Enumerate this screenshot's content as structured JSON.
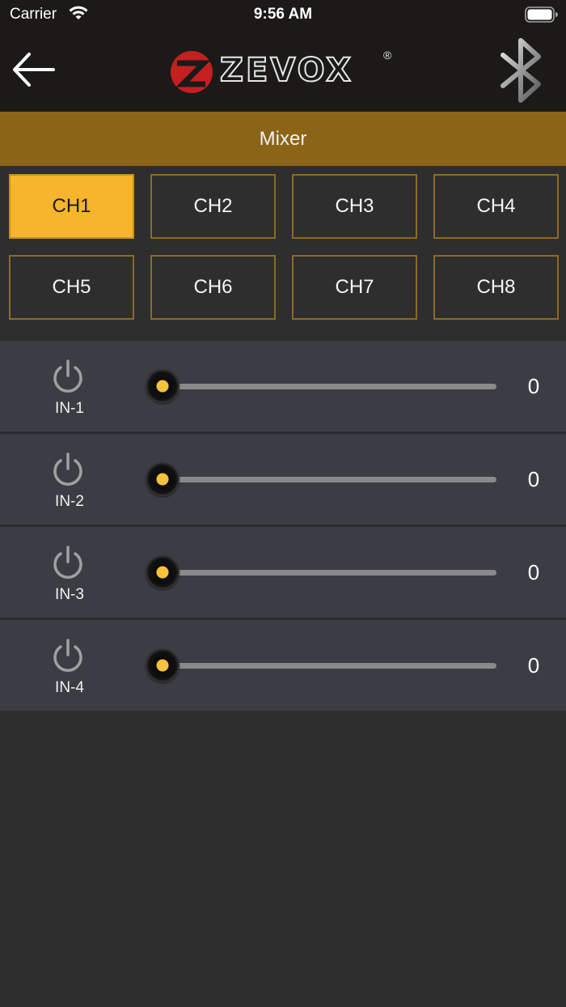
{
  "status_bar": {
    "carrier": "Carrier",
    "time": "9:56 AM"
  },
  "header": {
    "back_icon": "back-arrow-icon",
    "logo_text": "ZEVOX",
    "logo_registered": "®",
    "bluetooth_icon": "bluetooth-icon"
  },
  "section": {
    "title": "Mixer"
  },
  "channels": [
    {
      "label": "CH1",
      "active": true
    },
    {
      "label": "CH2",
      "active": false
    },
    {
      "label": "CH3",
      "active": false
    },
    {
      "label": "CH4",
      "active": false
    },
    {
      "label": "CH5",
      "active": false
    },
    {
      "label": "CH6",
      "active": false
    },
    {
      "label": "CH7",
      "active": false
    },
    {
      "label": "CH8",
      "active": false
    }
  ],
  "inputs": [
    {
      "label": "IN-1",
      "value": "0",
      "level": 0
    },
    {
      "label": "IN-2",
      "value": "0",
      "level": 0
    },
    {
      "label": "IN-3",
      "value": "0",
      "level": 0
    },
    {
      "label": "IN-4",
      "value": "0",
      "level": 0
    }
  ],
  "colors": {
    "accent": "#f7b52d",
    "header_bar": "#8b6417",
    "top_bar": "#1b1a19",
    "background": "#2e2e2e",
    "row_background": "#3b3d44",
    "logo_red": "#c4201f"
  }
}
